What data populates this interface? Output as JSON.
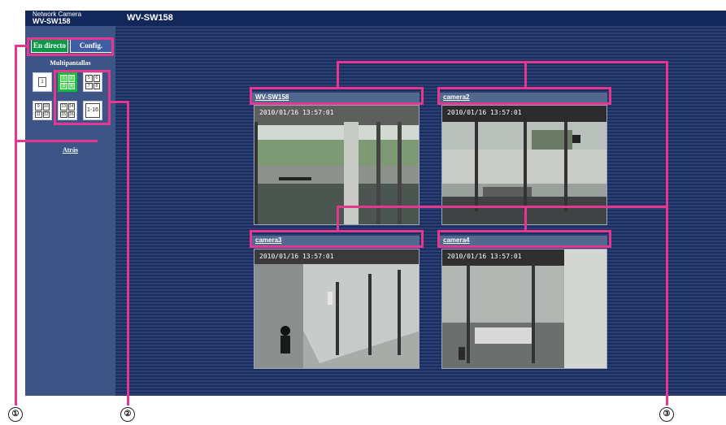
{
  "header": {
    "brand_sub": "Network Camera",
    "brand_model": "WV-SW158",
    "page_title": "WV-SW158"
  },
  "sidebar": {
    "live_label": "En directo",
    "config_label": "Config.",
    "multiscreen_label": "Multipantallas",
    "layouts": {
      "one": [
        "1"
      ],
      "four": [
        "1",
        "2",
        "3",
        "4"
      ],
      "six": [
        "5",
        "6",
        "7",
        "8"
      ],
      "nine": [
        "9",
        "10",
        "11",
        "12"
      ],
      "thirteen": [
        "13",
        "14",
        "15",
        "16"
      ],
      "sixteen": "1-16"
    },
    "back_label": "Atrás"
  },
  "cameras": [
    {
      "title": "WV-SW158",
      "timestamp": "2010/01/16 13:57:01"
    },
    {
      "title": "camera2",
      "timestamp": "2010/01/16 13:57:01"
    },
    {
      "title": "camera3",
      "timestamp": "2010/01/16 13:57:01"
    },
    {
      "title": "camera4",
      "timestamp": "2010/01/16 13:57:01"
    }
  ],
  "callouts": [
    "①",
    "②",
    "③"
  ],
  "colors": {
    "live_active": "#0a9a46",
    "highlight": "#e5378f",
    "panel_bg": "#1f3566"
  }
}
